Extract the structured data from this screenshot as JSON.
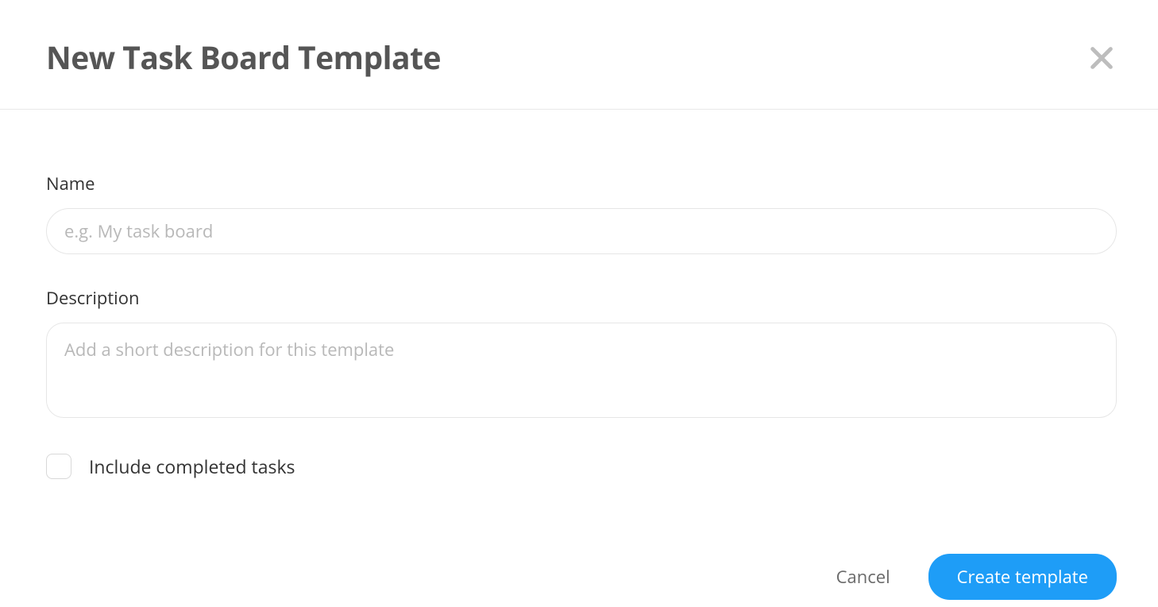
{
  "header": {
    "title": "New Task Board Template"
  },
  "form": {
    "name_label": "Name",
    "name_placeholder": "e.g. My task board",
    "name_value": "",
    "description_label": "Description",
    "description_placeholder": "Add a short description for this template",
    "description_value": "",
    "include_completed_label": "Include completed tasks",
    "include_completed_checked": false
  },
  "footer": {
    "cancel_label": "Cancel",
    "create_label": "Create template"
  }
}
